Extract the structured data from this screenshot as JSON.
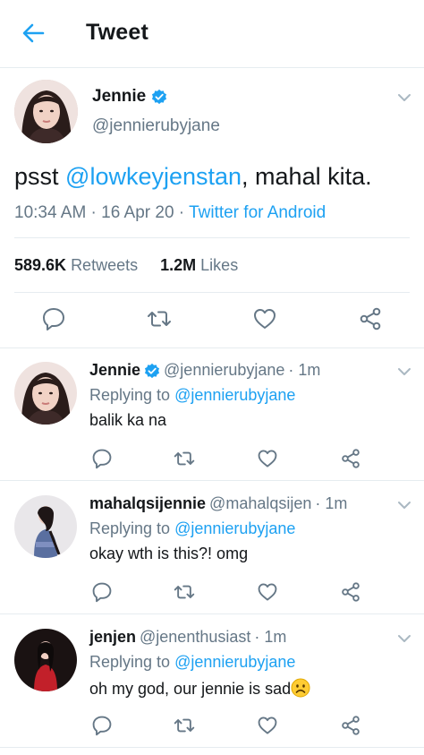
{
  "header": {
    "title": "Tweet"
  },
  "main_tweet": {
    "name": "Jennie",
    "handle": "@jennierubyjane",
    "text_prefix": "psst ",
    "mention": "@lowkeyjenstan",
    "text_suffix": ", mahal kita.",
    "time": "10:34 AM",
    "dot1": " · ",
    "date": "16 Apr 20",
    "dot2": " · ",
    "source": "Twitter for Android",
    "retweets_count": "589.6K",
    "retweets_label": "Retweets",
    "likes_count": "1.2M",
    "likes_label": "Likes"
  },
  "replies": [
    {
      "name": "Jennie",
      "handle": "@jennierubyjane",
      "time": "· 1m",
      "replying_label": "Replying to",
      "replying_to": "@jennierubyjane",
      "text": "balik ka na",
      "verified": true
    },
    {
      "name": "mahalqsijennie",
      "handle": "@mahalqsijen",
      "time": "· 1m",
      "replying_label": "Replying to",
      "replying_to": "@jennierubyjane",
      "text": "okay wth is this?! omg",
      "verified": false
    },
    {
      "name": "jenjen",
      "handle": "@jenenthusiast",
      "time": "· 1m",
      "replying_label": "Replying to",
      "replying_to": "@jennierubyjane",
      "text": "oh my god, our jennie is sad",
      "verified": false
    }
  ],
  "icons": {
    "back": "back-arrow-icon",
    "verified": "verified-badge-icon",
    "caret": "chevron-down-icon",
    "reply": "reply-icon",
    "retweet": "retweet-icon",
    "like": "heart-icon",
    "share": "share-icon",
    "sad_emoji": "frowning-face-emoji"
  },
  "colors": {
    "accent": "#1da1f2",
    "text": "#14171a",
    "secondary": "#657786",
    "divider": "#e6ecf0"
  }
}
